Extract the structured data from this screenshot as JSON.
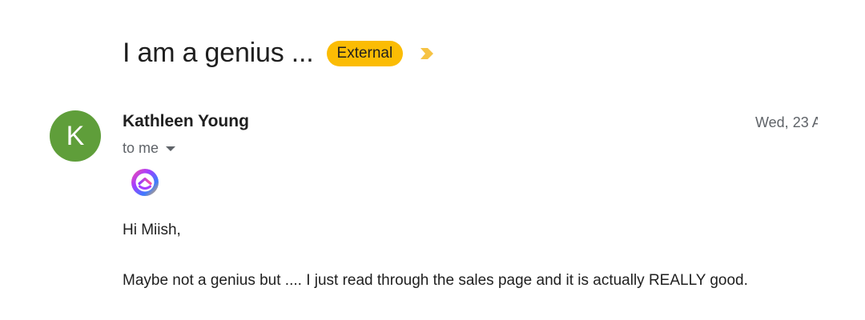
{
  "email": {
    "subject": "I am a genius ...",
    "label_badge": "External",
    "importance_icon": "importance-marker-icon",
    "colors": {
      "badge": "#fbbc04",
      "importance": "#f6c344",
      "avatar": "#5f9e3a"
    }
  },
  "sender": {
    "avatar_letter": "K",
    "name": "Kathleen Young",
    "date": "Wed, 23 A",
    "recipient": "to me",
    "logo_icon": "clickup-logo-icon"
  },
  "message": {
    "greeting": "Hi Miish,",
    "body": "Maybe not a genius but .... I just read through the sales page and it is actually REALLY good."
  }
}
